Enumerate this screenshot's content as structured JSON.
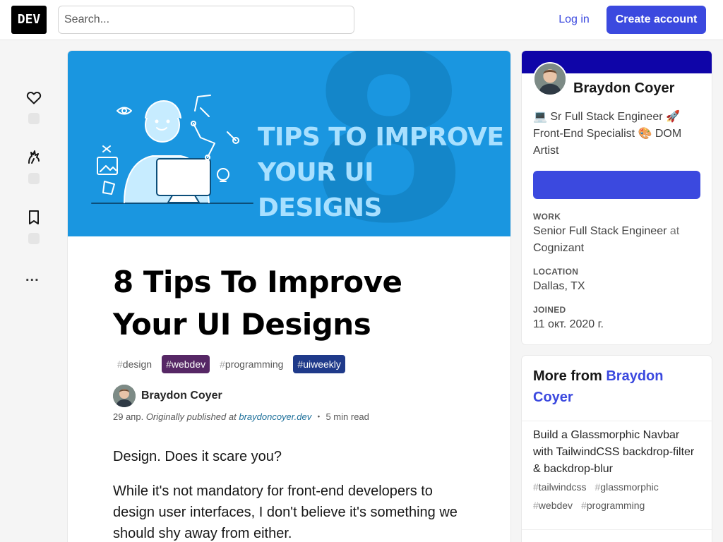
{
  "header": {
    "logo_text": "DEV",
    "search_placeholder": "Search...",
    "login_label": "Log in",
    "create_account_label": "Create account"
  },
  "reactions": {
    "heart_icon": "heart-icon",
    "unicorn_icon": "unicorn-icon",
    "bookmark_icon": "bookmark-icon",
    "more_label": "..."
  },
  "article": {
    "cover": {
      "big_number": "8",
      "line1": "TIPS TO IMPROVE",
      "line2": "YOUR UI DESIGNS"
    },
    "title": "8 Tips To Improve Your UI Designs",
    "tags": [
      {
        "hash": "#",
        "name": "design"
      },
      {
        "hash": "#",
        "name": "webdev"
      },
      {
        "hash": "#",
        "name": "programming"
      },
      {
        "hash": "#",
        "name": "uiweekly"
      }
    ],
    "author_name": "Braydon Coyer",
    "date": "29 апр.",
    "originally_published": "Originally published at",
    "source_link": "braydoncoyer.dev",
    "separator": "・",
    "read_time": "5 min read",
    "paragraphs": [
      "Design. Does it scare you?",
      "While it's not mandatory for front-end developers to design user interfaces, I don't believe it's something we should shy away from either."
    ]
  },
  "profile": {
    "name": "Braydon Coyer",
    "bio": "💻 Sr Full Stack Engineer 🚀 Front-End Specialist 🎨 DOM Artist",
    "follow_label": "",
    "work_label": "Work",
    "work_title": "Senior Full Stack Engineer",
    "work_at": "at",
    "work_company": "Cognizant",
    "location_label": "Location",
    "location_value": "Dallas, TX",
    "joined_label": "Joined",
    "joined_value": "11 окт. 2020 г.",
    "colors": {
      "brand_band": "#0f05a8",
      "button": "#3b49df"
    }
  },
  "more_from": {
    "heading_prefix": "More from",
    "heading_author": "Braydon Coyer",
    "post_title": "Build a Glassmorphic Navbar with TailwindCSS backdrop-filter & backdrop-blur",
    "post_tags": [
      {
        "hash": "#",
        "name": "tailwindcss"
      },
      {
        "hash": "#",
        "name": "glassmorphic"
      },
      {
        "hash": "#",
        "name": "webdev"
      },
      {
        "hash": "#",
        "name": "programming"
      }
    ]
  }
}
